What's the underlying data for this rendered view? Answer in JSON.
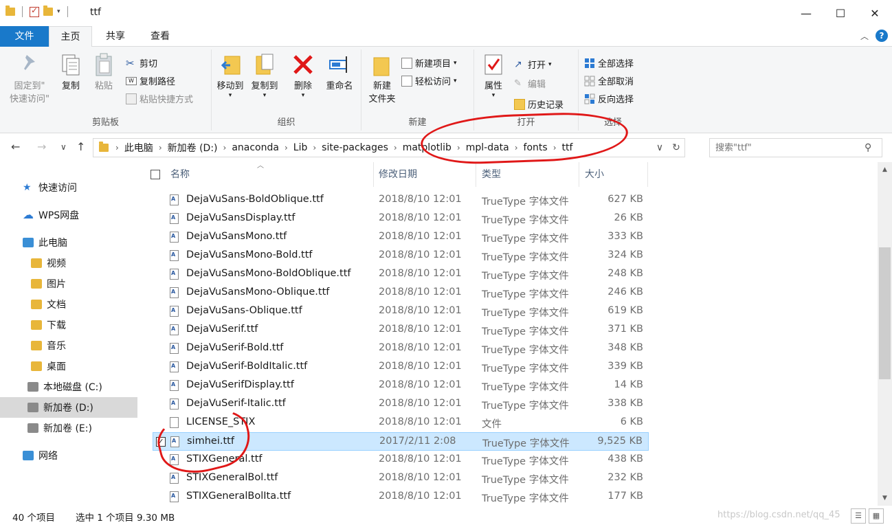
{
  "window": {
    "title": "ttf",
    "minimize": "—",
    "maximize": "☐",
    "close": "✕"
  },
  "ribbon_tabs": [
    "文件",
    "主页",
    "共享",
    "查看"
  ],
  "help": "?",
  "ribbon": {
    "clipboard": {
      "pin_quick_access": "固定到\"快速访问\"",
      "pin_line1": "固定到\"",
      "pin_line2": "快速访问\"",
      "copy": "复制",
      "paste": "粘贴",
      "cut": "剪切",
      "copy_path": "复制路径",
      "paste_shortcut": "粘贴快捷方式",
      "label": "剪贴板"
    },
    "organize": {
      "move_to": "移动到",
      "copy_to": "复制到",
      "delete": "删除",
      "rename": "重命名",
      "label": "组织"
    },
    "new": {
      "new_folder_line1": "新建",
      "new_folder_line2": "文件夹",
      "new_item": "新建项目",
      "easy_access": "轻松访问",
      "label": "新建"
    },
    "open": {
      "properties": "属性",
      "open": "打开",
      "edit": "编辑",
      "history": "历史记录",
      "label": "打开"
    },
    "select": {
      "select_all": "全部选择",
      "select_none": "全部取消",
      "invert": "反向选择",
      "label": "选择"
    }
  },
  "nav": {
    "back": "←",
    "forward": "→",
    "recent": "∨",
    "up": "↑",
    "breadcrumbs": [
      "此电脑",
      "新加卷 (D:)",
      "anaconda",
      "Lib",
      "site-packages",
      "matplotlib",
      "mpl-data",
      "fonts",
      "ttf"
    ],
    "search_placeholder": "搜索\"ttf\""
  },
  "navpane": [
    {
      "label": "快速访问",
      "icon": "star-icon"
    },
    {
      "label": "WPS网盘",
      "icon": "cloud-icon"
    },
    {
      "label": "此电脑",
      "icon": "computer-icon"
    },
    {
      "label": "视频",
      "icon": "video-folder-icon"
    },
    {
      "label": "图片",
      "icon": "pictures-folder-icon"
    },
    {
      "label": "文档",
      "icon": "documents-folder-icon"
    },
    {
      "label": "下载",
      "icon": "downloads-folder-icon"
    },
    {
      "label": "音乐",
      "icon": "music-folder-icon"
    },
    {
      "label": "桌面",
      "icon": "desktop-folder-icon"
    },
    {
      "label": "本地磁盘 (C:)",
      "icon": "drive-icon"
    },
    {
      "label": "新加卷 (D:)",
      "icon": "drive-icon",
      "selected": true
    },
    {
      "label": "新加卷 (E:)",
      "icon": "drive-icon"
    },
    {
      "label": "网络",
      "icon": "network-icon"
    }
  ],
  "columns": {
    "name": "名称",
    "date": "修改日期",
    "type": "类型",
    "size": "大小"
  },
  "files": [
    {
      "name": "DejaVuSans-BoldOblique.ttf",
      "date": "2018/8/10 12:01",
      "type": "TrueType 字体文件",
      "size": "627 KB"
    },
    {
      "name": "DejaVuSansDisplay.ttf",
      "date": "2018/8/10 12:01",
      "type": "TrueType 字体文件",
      "size": "26 KB"
    },
    {
      "name": "DejaVuSansMono.ttf",
      "date": "2018/8/10 12:01",
      "type": "TrueType 字体文件",
      "size": "333 KB"
    },
    {
      "name": "DejaVuSansMono-Bold.ttf",
      "date": "2018/8/10 12:01",
      "type": "TrueType 字体文件",
      "size": "324 KB"
    },
    {
      "name": "DejaVuSansMono-BoldOblique.ttf",
      "date": "2018/8/10 12:01",
      "type": "TrueType 字体文件",
      "size": "248 KB"
    },
    {
      "name": "DejaVuSansMono-Oblique.ttf",
      "date": "2018/8/10 12:01",
      "type": "TrueType 字体文件",
      "size": "246 KB"
    },
    {
      "name": "DejaVuSans-Oblique.ttf",
      "date": "2018/8/10 12:01",
      "type": "TrueType 字体文件",
      "size": "619 KB"
    },
    {
      "name": "DejaVuSerif.ttf",
      "date": "2018/8/10 12:01",
      "type": "TrueType 字体文件",
      "size": "371 KB"
    },
    {
      "name": "DejaVuSerif-Bold.ttf",
      "date": "2018/8/10 12:01",
      "type": "TrueType 字体文件",
      "size": "348 KB"
    },
    {
      "name": "DejaVuSerif-BoldItalic.ttf",
      "date": "2018/8/10 12:01",
      "type": "TrueType 字体文件",
      "size": "339 KB"
    },
    {
      "name": "DejaVuSerifDisplay.ttf",
      "date": "2018/8/10 12:01",
      "type": "TrueType 字体文件",
      "size": "14 KB"
    },
    {
      "name": "DejaVuSerif-Italic.ttf",
      "date": "2018/8/10 12:01",
      "type": "TrueType 字体文件",
      "size": "338 KB"
    },
    {
      "name": "LICENSE_STIX",
      "date": "2018/8/10 12:01",
      "type": "文件",
      "size": "6 KB",
      "plain": true
    },
    {
      "name": "simhei.ttf",
      "date": "2017/2/11 2:08",
      "type": "TrueType 字体文件",
      "size": "9,525 KB",
      "selected": true
    },
    {
      "name": "STIXGeneral.ttf",
      "date": "2018/8/10 12:01",
      "type": "TrueType 字体文件",
      "size": "438 KB"
    },
    {
      "name": "STIXGeneralBol.ttf",
      "date": "2018/8/10 12:01",
      "type": "TrueType 字体文件",
      "size": "232 KB"
    },
    {
      "name": "STIXGeneralBolIta.ttf",
      "date": "2018/8/10 12:01",
      "type": "TrueType 字体文件",
      "size": "177 KB"
    }
  ],
  "status": {
    "count": "40 个项目",
    "selected": "选中 1 个项目  9.30 MB",
    "watermark": "https://blog.csdn.net/qq_45"
  },
  "colors": {
    "accent": "#1979ca",
    "selection": "#cce8ff",
    "annotation": "#e01818"
  }
}
